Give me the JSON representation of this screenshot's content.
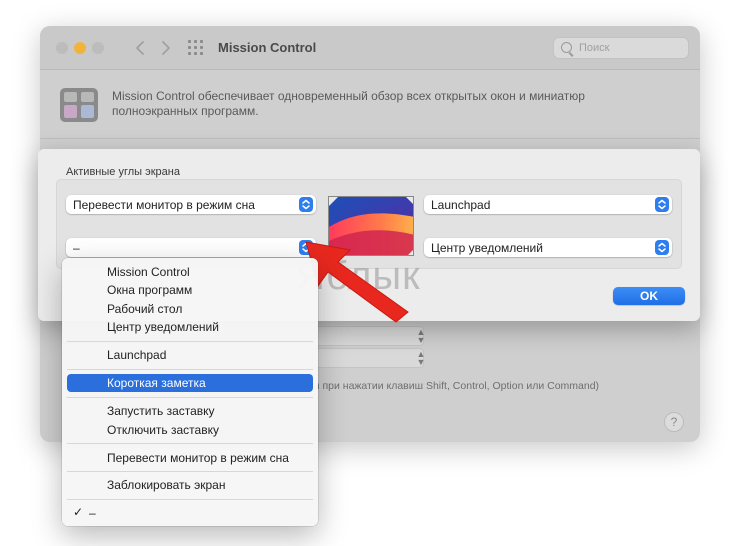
{
  "window": {
    "title": "Mission Control",
    "search_placeholder": "Поиск",
    "description": "Mission Control обеспечивает одновременный обзор всех открытых окон и миниатюр полноэкранных программ.",
    "hint_text": "ы при нажатии клавиш Shift, Control, Option или Command)",
    "help_label": "?"
  },
  "sheet": {
    "group_label": "Активные углы экрана",
    "top_left": "Перевести монитор в режим сна",
    "top_right": "Launchpad",
    "bottom_left": "–",
    "bottom_right": "Центр уведомлений",
    "ok_label": "OK"
  },
  "watermark": "Яблык",
  "menu": {
    "items": [
      {
        "label": "Mission Control"
      },
      {
        "label": "Окна программ"
      },
      {
        "label": "Рабочий стол"
      },
      {
        "label": "Центр уведомлений"
      },
      {
        "label": "Launchpad"
      },
      {
        "label": "Короткая заметка"
      },
      {
        "label": "Запустить заставку"
      },
      {
        "label": "Отключить заставку"
      },
      {
        "label": "Перевести монитор в режим сна"
      },
      {
        "label": "Заблокировать экран"
      },
      {
        "label": "–"
      }
    ],
    "selected": "Короткая заметка",
    "checked": "–",
    "check_glyph": "✓"
  },
  "colors": {
    "accent": "#2a6fdc",
    "arrow": "#e8281e",
    "traffic_yellow": "#f0b43c"
  }
}
